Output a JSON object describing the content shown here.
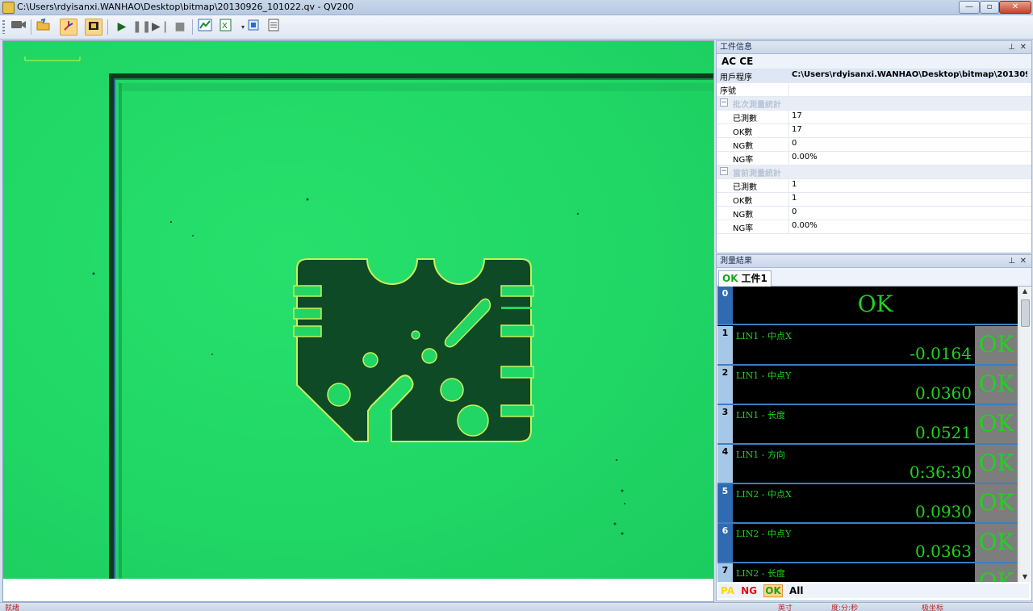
{
  "window": {
    "title": "C:\\Users\\rdyisanxi.WANHAO\\Desktop\\bitmap\\20130926_101022.qv - QV200",
    "buttons": {
      "minimize": "—",
      "maximize": "▫",
      "close": "✕"
    }
  },
  "toolbar": {
    "icons": [
      "camera-icon",
      "open-folder-icon",
      "edge-tool-icon",
      "measure-tool-icon",
      "play-icon",
      "pause-icon",
      "step-icon",
      "stop-icon",
      "chart-icon",
      "excel-export-icon",
      "settings-icon",
      "notes-icon"
    ]
  },
  "viewer": {
    "scale_label": ""
  },
  "info_panel": {
    "header": "工件信息",
    "top_label": "AC  CE",
    "rows": [
      {
        "key": "用戶程序",
        "value": "C:\\Users\\rdyisanxi.WANHAO\\Desktop\\bitmap\\20130926_..."
      },
      {
        "key": "序號",
        "value": ""
      }
    ],
    "cat_total": {
      "label": "批次測量統計",
      "rows": [
        {
          "key": "已測數",
          "value": "17"
        },
        {
          "key": "OK數",
          "value": "17"
        },
        {
          "key": "NG數",
          "value": "0"
        },
        {
          "key": "NG率",
          "value": "0.00%"
        }
      ]
    },
    "cat_current": {
      "label": "當前測量統計",
      "rows": [
        {
          "key": "已測數",
          "value": "1"
        },
        {
          "key": "OK數",
          "value": "1"
        },
        {
          "key": "NG數",
          "value": "0"
        },
        {
          "key": "NG率",
          "value": "0.00%"
        }
      ]
    }
  },
  "result_panel": {
    "header": "測量結果",
    "tab": {
      "status": "OK",
      "label": "工件1"
    },
    "total": {
      "index": "0",
      "status": "OK"
    },
    "items": [
      {
        "index": "1",
        "name": "LIN1 - 中点X",
        "value": "-0.0164",
        "status": "OK"
      },
      {
        "index": "2",
        "name": "LIN1 - 中点Y",
        "value": "0.0360",
        "status": "OK"
      },
      {
        "index": "3",
        "name": "LIN1 - 长度",
        "value": "0.0521",
        "status": "OK"
      },
      {
        "index": "4",
        "name": "LIN1 - 方向",
        "value": "0:36:30",
        "status": "OK"
      },
      {
        "index": "5",
        "name": "LIN2 - 中点X",
        "value": "0.0930",
        "status": "OK"
      },
      {
        "index": "6",
        "name": "LIN2 - 中点Y",
        "value": "0.0363",
        "status": "OK"
      },
      {
        "index": "7",
        "name": "LIN2 - 长度",
        "value": "",
        "status": "OK"
      }
    ],
    "filters": {
      "pa": "PA",
      "ng": "NG",
      "ok": "OK",
      "all": "All"
    }
  },
  "statusbar": {
    "left": "就绪",
    "unit": "英寸",
    "time": "度:分:秒",
    "coord": "极坐标"
  }
}
